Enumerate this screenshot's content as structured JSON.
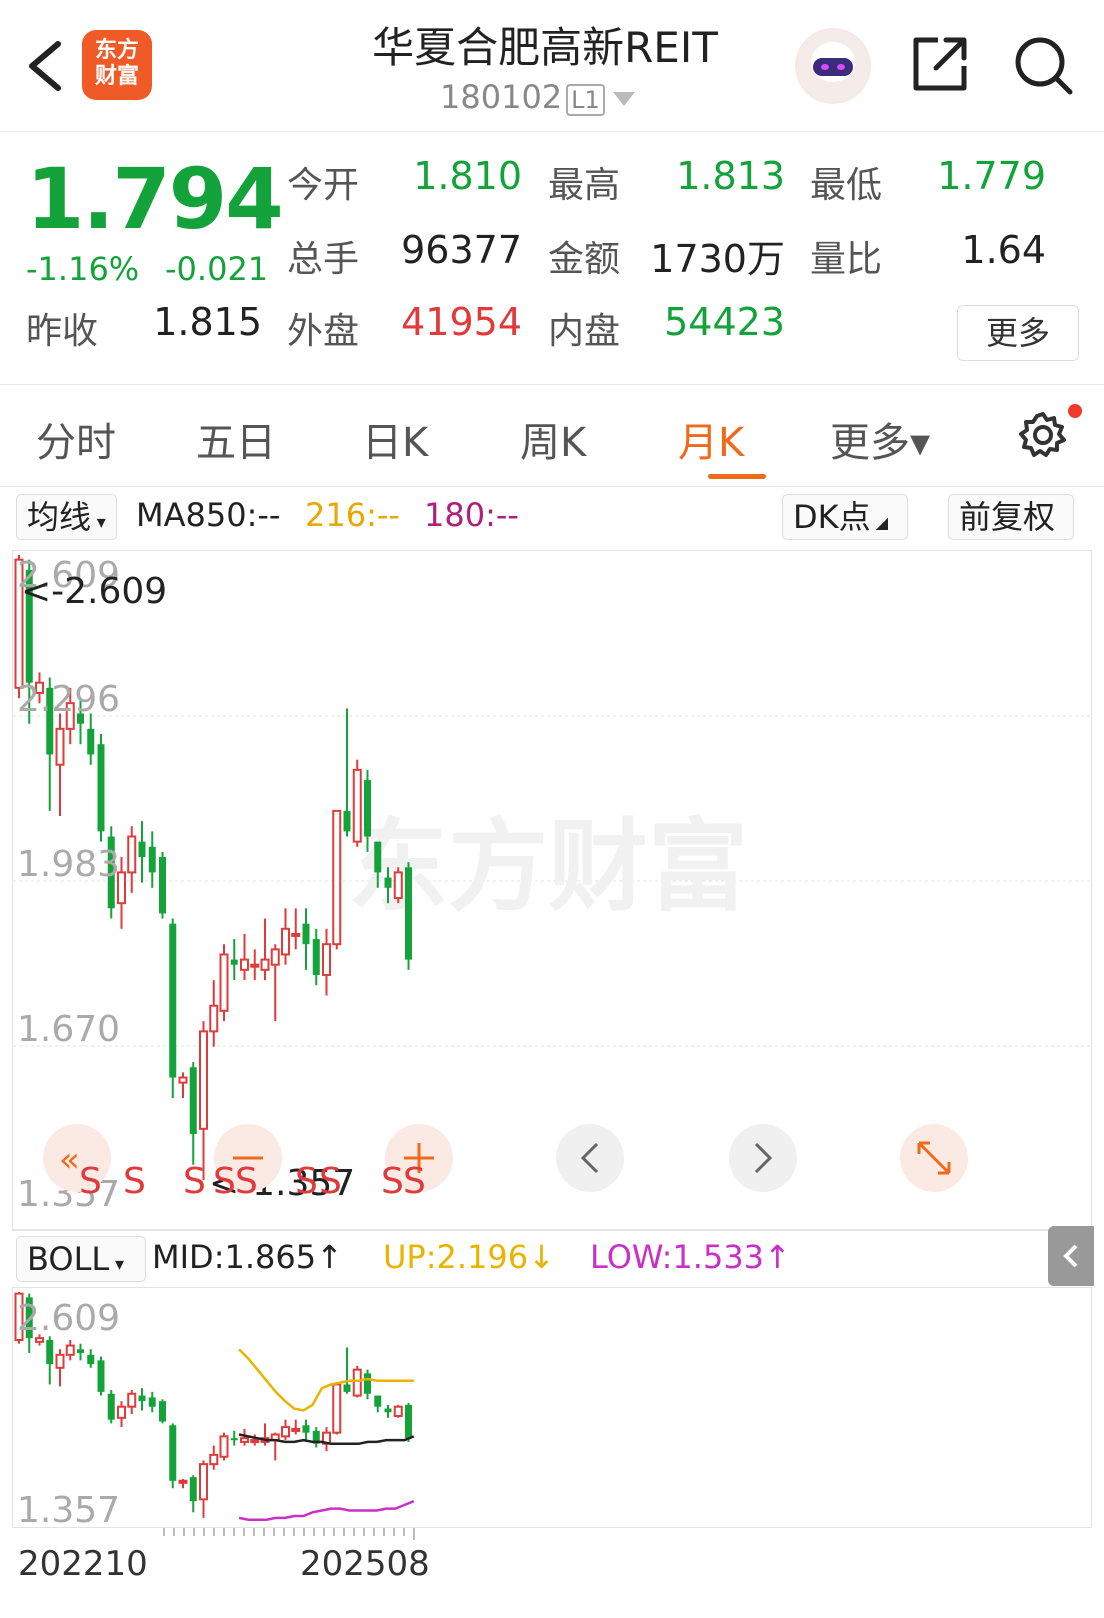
{
  "header": {
    "title": "华夏合肥高新REIT",
    "code": "180102",
    "level": "L1",
    "logo_text": [
      "东方",
      "财富"
    ]
  },
  "quote": {
    "price": "1.794",
    "change_pct": "-1.16%",
    "change": "-0.021",
    "labels": {
      "open": "今开",
      "high": "最高",
      "low": "最低",
      "volume": "总手",
      "amount": "金额",
      "volume_ratio": "量比",
      "prev_close": "昨收",
      "outer": "外盘",
      "inner": "内盘"
    },
    "values": {
      "open": "1.810",
      "high": "1.813",
      "low": "1.779",
      "volume": "96377",
      "amount": "1730万",
      "volume_ratio": "1.64",
      "prev_close": "1.815",
      "outer": "41954",
      "inner": "54423"
    },
    "more_label": "更多"
  },
  "tabs": [
    {
      "label": "分时"
    },
    {
      "label": "五日"
    },
    {
      "label": "日K"
    },
    {
      "label": "周K"
    },
    {
      "label": "月K",
      "active": true
    },
    {
      "label": "更多▾"
    }
  ],
  "indicator_bar": {
    "ma_select": "均线",
    "ma850": "MA850:--",
    "ma216": "216:--",
    "ma180": "180:--",
    "dk_label": "DK点",
    "adjust_label": "前复权"
  },
  "main_chart": {
    "y_ticks": [
      "2.609",
      "2.296",
      "1.983",
      "1.670",
      "1.357"
    ],
    "max_annotation": "<-2.609",
    "min_annotation": "<-1.357",
    "watermark": "东方财富",
    "s_markers": [
      "S",
      "S",
      "S",
      "S",
      "S",
      "S",
      "S",
      "S",
      "S"
    ]
  },
  "boll": {
    "select": "BOLL",
    "mid": "MID:1.865↑",
    "up": "UP:2.196↓",
    "low": "LOW:1.533↑",
    "y_ticks": [
      "2.609",
      "1.357"
    ]
  },
  "dates": {
    "start": "202210",
    "end": "202508"
  },
  "colors": {
    "up": "#e03a3a",
    "down": "#14a33a",
    "accent": "#ef6a1b",
    "boll_up": "#e8b400",
    "boll_low": "#c930c9",
    "boll_mid": "#222222"
  },
  "chart_data": {
    "type": "candlestick",
    "ylim": [
      1.357,
      2.609
    ],
    "candles": [
      [
        2.35,
        2.6,
        2.609,
        2.33
      ],
      [
        2.58,
        2.36,
        2.6,
        2.28
      ],
      [
        2.34,
        2.36,
        2.38,
        2.32
      ],
      [
        2.35,
        2.22,
        2.37,
        2.11
      ],
      [
        2.2,
        2.27,
        2.3,
        2.1
      ],
      [
        2.27,
        2.32,
        2.35,
        2.24
      ],
      [
        2.3,
        2.28,
        2.33,
        2.24
      ],
      [
        2.27,
        2.22,
        2.3,
        2.2
      ],
      [
        2.24,
        2.07,
        2.26,
        2.05
      ],
      [
        2.06,
        1.92,
        2.08,
        1.9
      ],
      [
        1.93,
        1.99,
        2.02,
        1.88
      ],
      [
        1.99,
        2.06,
        2.08,
        1.95
      ],
      [
        2.05,
        2.02,
        2.09,
        1.97
      ],
      [
        2.04,
        1.99,
        2.07,
        1.96
      ],
      [
        2.02,
        1.91,
        2.03,
        1.9
      ],
      [
        1.89,
        1.59,
        1.9,
        1.55
      ],
      [
        1.58,
        1.59,
        1.6,
        1.55
      ],
      [
        1.61,
        1.48,
        1.62,
        1.42
      ],
      [
        1.49,
        1.68,
        1.7,
        1.39
      ],
      [
        1.68,
        1.73,
        1.78,
        1.65
      ],
      [
        1.72,
        1.83,
        1.85,
        1.7
      ],
      [
        1.82,
        1.81,
        1.86,
        1.78
      ],
      [
        1.8,
        1.82,
        1.87,
        1.78
      ],
      [
        1.81,
        1.81,
        1.84,
        1.78
      ],
      [
        1.8,
        1.82,
        1.9,
        1.78
      ],
      [
        1.81,
        1.84,
        1.85,
        1.7
      ],
      [
        1.83,
        1.88,
        1.92,
        1.81
      ],
      [
        1.87,
        1.87,
        1.92,
        1.84
      ],
      [
        1.89,
        1.85,
        1.92,
        1.8
      ],
      [
        1.86,
        1.79,
        1.88,
        1.77
      ],
      [
        1.79,
        1.85,
        1.88,
        1.75
      ],
      [
        1.85,
        2.11,
        2.11,
        1.84
      ],
      [
        2.11,
        2.07,
        2.31,
        2.06
      ],
      [
        2.05,
        2.19,
        2.21,
        2.04
      ],
      [
        2.17,
        2.06,
        2.19,
        2.03
      ],
      [
        2.05,
        1.99,
        2.05,
        1.96
      ],
      [
        1.98,
        1.96,
        2.0,
        1.93
      ],
      [
        1.94,
        1.99,
        2.0,
        1.93
      ],
      [
        2.0,
        1.82,
        2.01,
        1.8
      ]
    ],
    "boll_up": [
      2.3,
      2.25,
      2.19,
      2.13,
      2.07,
      2.02,
      1.98,
      1.97,
      2.0,
      2.09,
      2.11,
      2.12,
      2.13,
      2.13,
      2.14,
      2.13,
      2.13,
      2.13,
      2.13,
      2.13
    ],
    "boll_mid": [
      1.84,
      1.83,
      1.82,
      1.81,
      1.81,
      1.8,
      1.8,
      1.81,
      1.8,
      1.8,
      1.79,
      1.79,
      1.79,
      1.79,
      1.8,
      1.8,
      1.81,
      1.81,
      1.81,
      1.83
    ],
    "boll_low": [
      1.39,
      1.38,
      1.38,
      1.38,
      1.39,
      1.39,
      1.4,
      1.4,
      1.42,
      1.43,
      1.44,
      1.44,
      1.43,
      1.43,
      1.43,
      1.43,
      1.44,
      1.44,
      1.46,
      1.48
    ]
  }
}
